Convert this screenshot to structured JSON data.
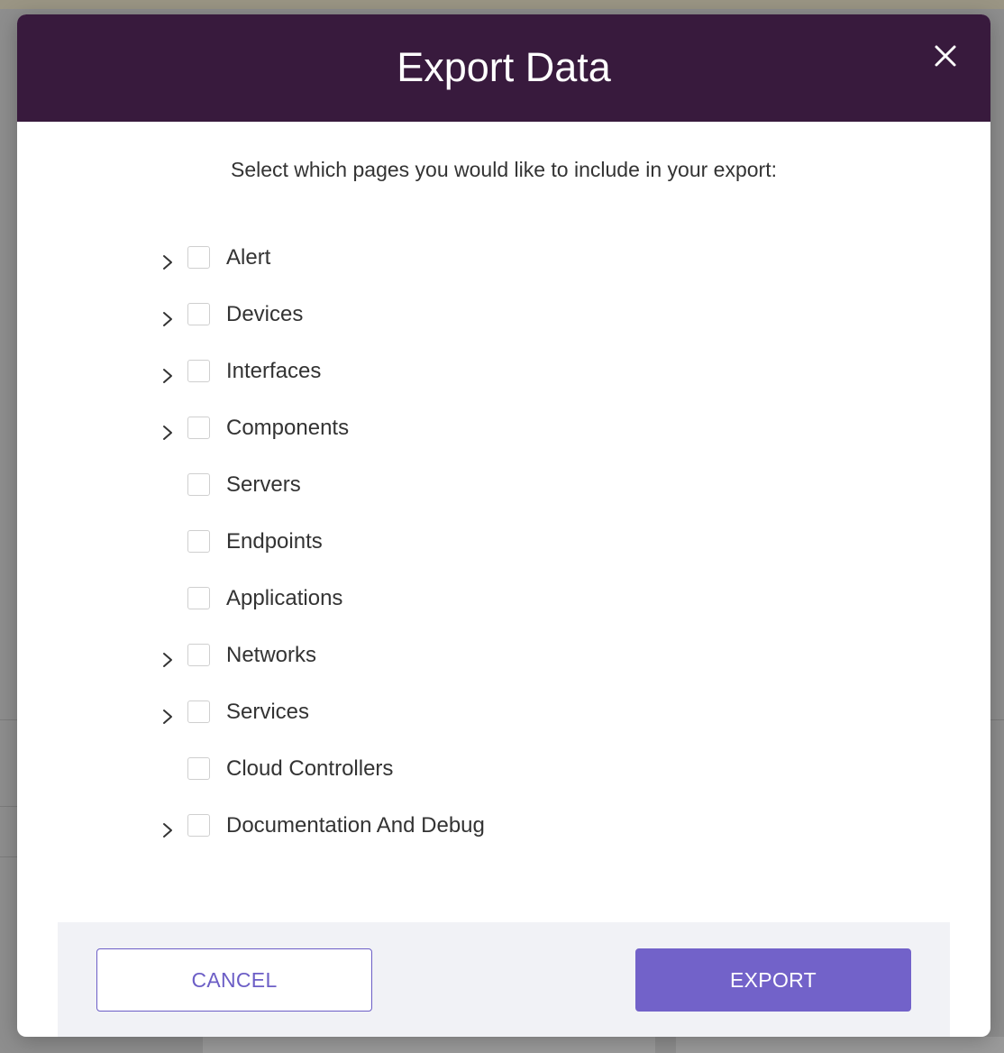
{
  "modal": {
    "title": "Export Data",
    "instructions": "Select which pages you would like to include in your export:",
    "close_icon": "close-icon"
  },
  "pages": [
    {
      "label": "Alert",
      "expandable": true,
      "checked": false
    },
    {
      "label": "Devices",
      "expandable": true,
      "checked": false
    },
    {
      "label": "Interfaces",
      "expandable": true,
      "checked": false
    },
    {
      "label": "Components",
      "expandable": true,
      "checked": false
    },
    {
      "label": "Servers",
      "expandable": false,
      "checked": false
    },
    {
      "label": "Endpoints",
      "expandable": false,
      "checked": false
    },
    {
      "label": "Applications",
      "expandable": false,
      "checked": false
    },
    {
      "label": "Networks",
      "expandable": true,
      "checked": false
    },
    {
      "label": "Services",
      "expandable": true,
      "checked": false
    },
    {
      "label": "Cloud Controllers",
      "expandable": false,
      "checked": false
    },
    {
      "label": "Documentation And Debug",
      "expandable": true,
      "checked": false
    }
  ],
  "footer": {
    "cancel_label": "CANCEL",
    "export_label": "EXPORT"
  },
  "colors": {
    "header_bg": "#381a3d",
    "accent": "#7262c9",
    "footer_bg": "#f1f2f6"
  }
}
